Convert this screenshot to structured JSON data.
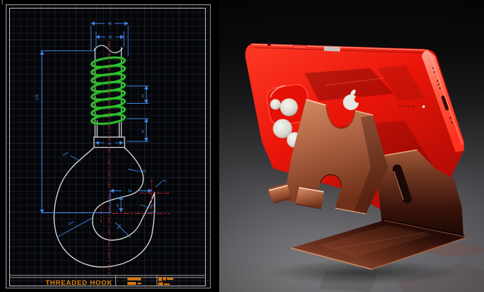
{
  "left_panel": {
    "title_block": {
      "title": "THREADED HOOK"
    },
    "dim_labels": {
      "spring_od": "48",
      "shaft_od": "36",
      "height": "175",
      "pitch_upper": "24",
      "pitch_lower": "32",
      "collar": "44",
      "throat_width": "54",
      "tip_offset": "25",
      "r_shank": "R40",
      "r_throat": "R30",
      "r_tip": "R3",
      "r_tip_inner": "R25",
      "r_tip_small": "R4",
      "r_bowl": "R54",
      "r_bowl_back": "R40"
    },
    "colors": {
      "background": "#05060a",
      "sheet_border": "#b8b8b8",
      "outline_white": "#d4d4d4",
      "dimension_blue": "#3d84e0",
      "centerline_red": "#c42424",
      "thread_green": "#2ec42e",
      "title_orange": "#e0820f"
    }
  },
  "right_panel": {
    "colors": {
      "phone_red": "#e81408",
      "phone_edge_pink": "#ff6a52",
      "camera_lens_silver": "#e8e8e2",
      "stand_copper": "#b06a4a",
      "stand_dark_brown": "#2c0e08",
      "floor_gray": "#7c7c80"
    }
  }
}
